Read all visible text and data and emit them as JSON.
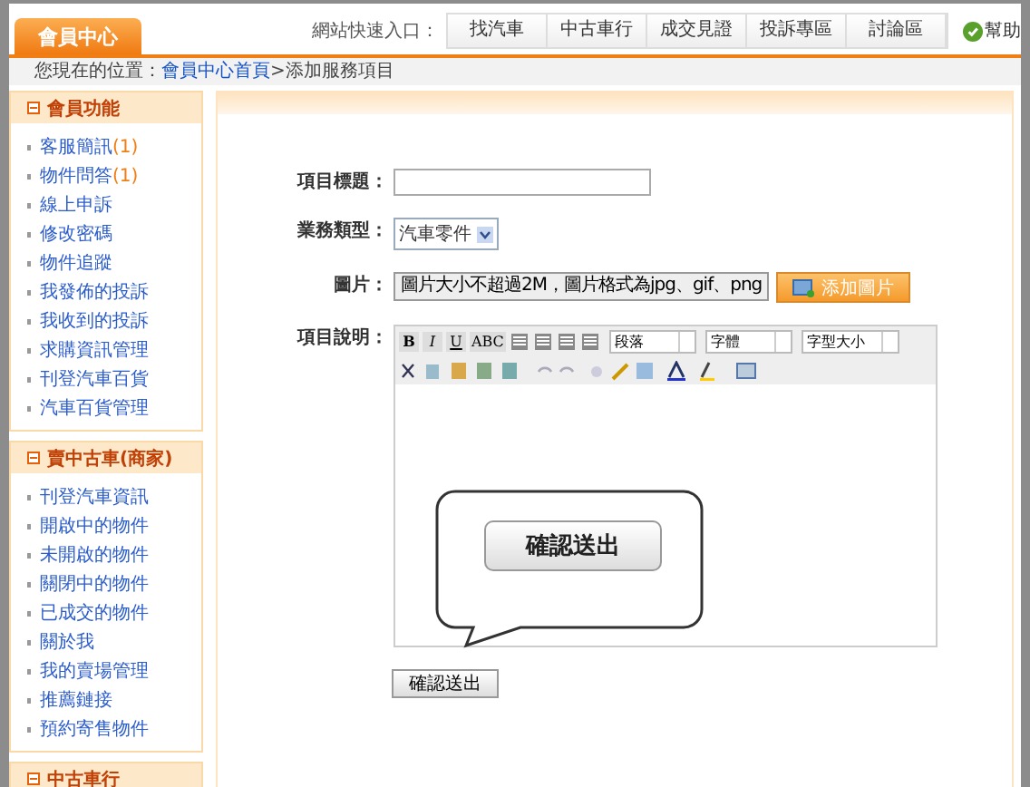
{
  "header": {
    "tab": "會員中心",
    "quick_label": "網站快速入口：",
    "quick_links": [
      "找汽車",
      "中古車行",
      "成交見證",
      "投訴專區",
      "討論區"
    ],
    "help": "幫助"
  },
  "breadcrumb": {
    "prefix": "您現在的位置：",
    "link": "會員中心首頁",
    "current": ">添加服務項目"
  },
  "sidebar": [
    {
      "title": "會員功能",
      "items": [
        {
          "label": "客服簡訊",
          "count": "(1)"
        },
        {
          "label": "物件問答",
          "count": "(1)"
        },
        {
          "label": "線上申訴"
        },
        {
          "label": "修改密碼"
        },
        {
          "label": "物件追蹤"
        },
        {
          "label": "我發佈的投訴"
        },
        {
          "label": "我收到的投訴"
        },
        {
          "label": "求購資訊管理"
        },
        {
          "label": "刊登汽車百貨"
        },
        {
          "label": "汽車百貨管理"
        }
      ]
    },
    {
      "title": "賣中古車(商家)",
      "items": [
        {
          "label": "刊登汽車資訊"
        },
        {
          "label": "開啟中的物件"
        },
        {
          "label": "未開啟的物件"
        },
        {
          "label": "關閉中的物件"
        },
        {
          "label": "已成交的物件"
        },
        {
          "label": "關於我"
        },
        {
          "label": "我的賣場管理"
        },
        {
          "label": "推薦鏈接"
        },
        {
          "label": "預約寄售物件"
        }
      ]
    },
    {
      "title": "中古車行"
    }
  ],
  "form": {
    "title_label": "項目標題：",
    "type_label": "業務類型：",
    "type_value": "汽車零件",
    "image_label": "圖片：",
    "image_value": "圖片大小不超過2M，圖片格式為jpg、gif、png",
    "add_image": "添加圖片",
    "desc_label": "項目說明：",
    "format_buttons": [
      "B",
      "I",
      "U",
      "ABC"
    ],
    "dropdowns": [
      "段落",
      "字體",
      "字型大小"
    ],
    "submit": "確認送出"
  },
  "callout": {
    "label": "確認送出"
  }
}
